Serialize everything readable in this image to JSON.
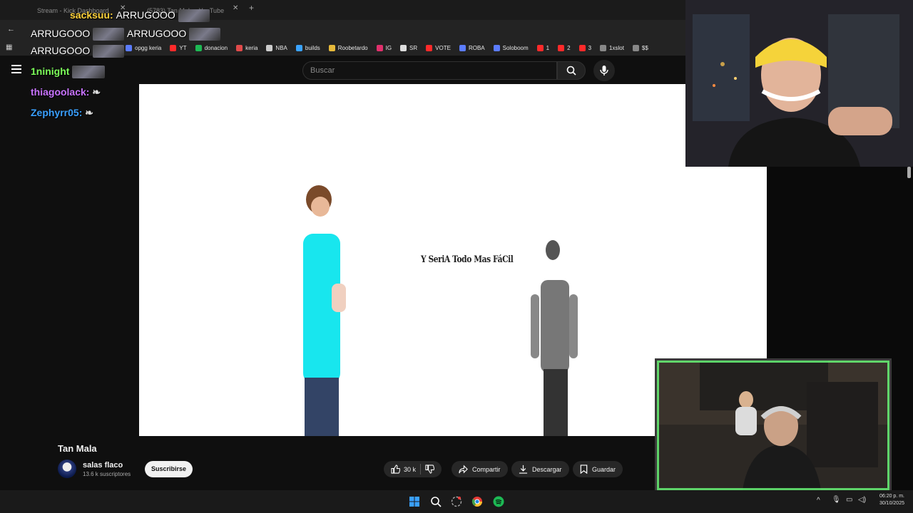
{
  "browser": {
    "tabs": [
      {
        "label": "Stream - Kick Dashboard"
      },
      {
        "label": "(5783) Tan Mala - YouTube"
      }
    ],
    "bookmarks": [
      {
        "label": "opgg keria",
        "color": "#5b7cff"
      },
      {
        "label": "YT",
        "color": "#ff2a2a"
      },
      {
        "label": "donacion",
        "color": "#1db954"
      },
      {
        "label": "keria",
        "color": "#e04a4a"
      },
      {
        "label": "NBA",
        "color": "#cccccc"
      },
      {
        "label": "builds",
        "color": "#3aa3ff"
      },
      {
        "label": "Roobetardo",
        "color": "#e6b93a"
      },
      {
        "label": "IG",
        "color": "#e1306c"
      },
      {
        "label": "SR",
        "color": "#dddddd"
      },
      {
        "label": "VOTE",
        "color": "#ff2a2a"
      },
      {
        "label": "ROBA",
        "color": "#5b7cff"
      },
      {
        "label": "Soloboom",
        "color": "#5b7cff"
      },
      {
        "label": "1",
        "color": "#ff2a2a"
      },
      {
        "label": "2",
        "color": "#ff2a2a"
      },
      {
        "label": "3",
        "color": "#ff2a2a"
      },
      {
        "label": "1xslot",
        "color": "#888888"
      },
      {
        "label": "$$",
        "color": "#888888"
      }
    ]
  },
  "search": {
    "placeholder": "Buscar"
  },
  "chat": [
    {
      "user": "sacksuu:",
      "user_color": "#ffd23a",
      "text": "ARRUGOOO"
    },
    {
      "user": "",
      "user_color": "#ffffff",
      "text": "ARRUGOOO"
    },
    {
      "user": "",
      "user_color": "#ffffff",
      "text": "ARRUGOOO"
    },
    {
      "user": "",
      "user_color": "#ffffff",
      "text": "ARRUGOOO"
    },
    {
      "user": "1ninight",
      "user_color": "#7dff5a",
      "text": ""
    },
    {
      "user": "thiagoolack:",
      "user_color": "#c873ff",
      "text": ""
    },
    {
      "user": "Zephyrr05:",
      "user_color": "#3aa0ff",
      "text": ""
    }
  ],
  "video": {
    "caption": "Y SeriA Todo Mas FáCil"
  },
  "below": {
    "title": "Tan Mala",
    "channel": "salas flaco",
    "subscribers": "13.6 k suscriptores",
    "subscribe_label": "Suscribirse",
    "likes": "30 k",
    "share_label": "Compartir",
    "download_label": "Descargar",
    "save_label": "Guardar"
  },
  "clock": {
    "time": "06:20 p. m.",
    "date": "30/10/2025"
  }
}
